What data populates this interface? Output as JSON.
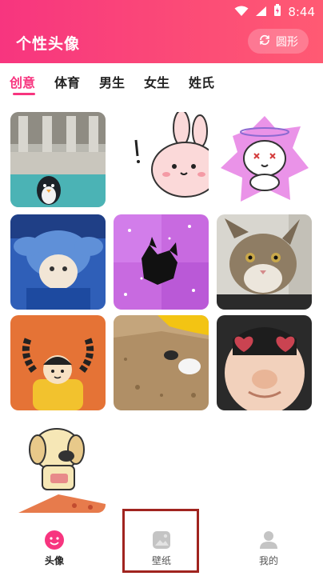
{
  "status": {
    "time": "8:44"
  },
  "header": {
    "title": "个性头像",
    "shape_toggle_label": "圆形"
  },
  "tabs": [
    {
      "label": "创意",
      "active": true
    },
    {
      "label": "体育",
      "active": false
    },
    {
      "label": "男生",
      "active": false
    },
    {
      "label": "女生",
      "active": false
    },
    {
      "label": "姓氏",
      "active": false
    }
  ],
  "avatars": [
    "fountain-penguin-photo",
    "pink-bunny-sticker",
    "doodle-dog-sticker",
    "stitch-plush-photo",
    "black-cat-glitter-photo",
    "tabby-cat-photo",
    "braids-girl-sticker",
    "dog-on-sand-photo",
    "heart-glasses-kid-photo",
    "sketch-dog-pizza-sticker"
  ],
  "bottom_nav": [
    {
      "label": "头像",
      "icon": "face-icon",
      "active": true
    },
    {
      "label": "壁纸",
      "icon": "wallpaper-icon",
      "active": false
    },
    {
      "label": "我的",
      "icon": "person-icon",
      "active": false
    }
  ],
  "colors": {
    "accent": "#f7357f",
    "highlight": "#a0241f"
  }
}
